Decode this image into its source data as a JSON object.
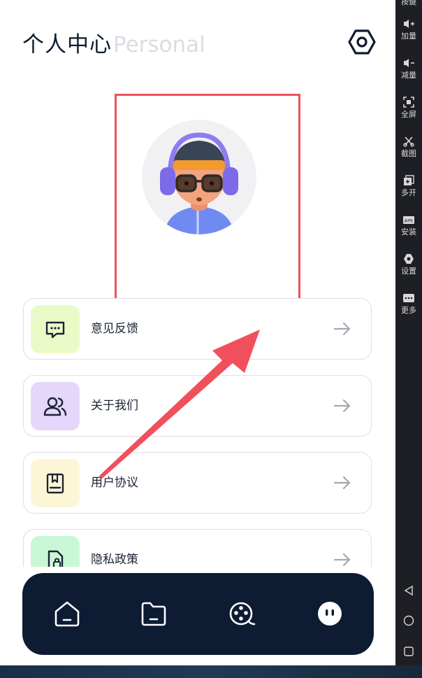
{
  "header": {
    "title": "个人中心",
    "subtitle": "Personal",
    "settings_icon": "hexagon-settings-icon"
  },
  "profile": {
    "avatar": "3d-avatar-headphones-glasses"
  },
  "menu": [
    {
      "label": "意见反馈",
      "icon": "message-icon",
      "bg": "#ebfbc7"
    },
    {
      "label": "关于我们",
      "icon": "users-icon",
      "bg": "#e4d7fb"
    },
    {
      "label": "用户协议",
      "icon": "book-icon",
      "bg": "#fdf6d6"
    },
    {
      "label": "隐私政策",
      "icon": "file-lock-icon",
      "bg": "#c9f7d6"
    }
  ],
  "tabbar": {
    "tabs": [
      {
        "icon": "home-icon"
      },
      {
        "icon": "folder-icon"
      },
      {
        "icon": "film-reel-icon"
      },
      {
        "icon": "profile-face-icon",
        "active": true
      }
    ]
  },
  "emulator_sidebar": {
    "buttons": [
      "按键",
      "加量",
      "减量",
      "全屏",
      "截图",
      "多开",
      "安装",
      "设置",
      "更多"
    ],
    "nav": [
      "back-icon",
      "home-circle-icon",
      "recents-icon"
    ]
  },
  "annotation": {
    "highlight_color": "#f0505c",
    "arrow_color": "#f0505c"
  }
}
